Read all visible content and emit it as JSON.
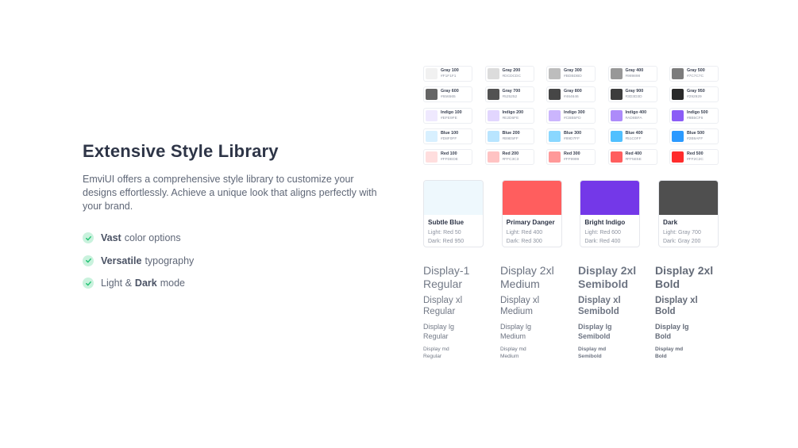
{
  "heading": "Extensive Style Library",
  "description": "EmviUI offers a comprehensive style library to customize your designs effortlessly. Achieve a unique look that aligns perfectly with your brand.",
  "features": [
    {
      "pre": "",
      "bold": "Vast",
      "post": "color options"
    },
    {
      "pre": "",
      "bold": "Versatile",
      "post": "typography"
    },
    {
      "pre": "Light &",
      "bold": "Dark",
      "post": "mode"
    }
  ],
  "check_color": "#22c373",
  "swatches": [
    [
      {
        "name": "Gray 100",
        "hex": "#F1F1F1",
        "color": "#f1f1f1"
      },
      {
        "name": "Gray 200",
        "hex": "#DCDCDC",
        "color": "#dcdcdc"
      },
      {
        "name": "Gray 300",
        "hex": "#BDBDBD",
        "color": "#bdbdbd"
      },
      {
        "name": "Gray 400",
        "hex": "#989898",
        "color": "#989898"
      },
      {
        "name": "Gray 500",
        "hex": "#7C7C7C",
        "color": "#7c7c7c"
      }
    ],
    [
      {
        "name": "Gray 600",
        "hex": "#656565",
        "color": "#656565"
      },
      {
        "name": "Gray 700",
        "hex": "#525252",
        "color": "#525252"
      },
      {
        "name": "Gray 800",
        "hex": "#464646",
        "color": "#464646"
      },
      {
        "name": "Gray 900",
        "hex": "#3D3D3D",
        "color": "#3d3d3d"
      },
      {
        "name": "Gray 950",
        "hex": "#292929",
        "color": "#292929"
      }
    ],
    [
      {
        "name": "Indigo 100",
        "hex": "#EFE9FE",
        "color": "#efe9fe"
      },
      {
        "name": "Indigo 200",
        "hex": "#E2D6FE",
        "color": "#e2d6fe"
      },
      {
        "name": "Indigo 300",
        "hex": "#CBB5FD",
        "color": "#cbb5fd"
      },
      {
        "name": "Indigo 400",
        "hex": "#AD8BFA",
        "color": "#ad8bfa"
      },
      {
        "name": "Indigo 500",
        "hex": "#8B5CF6",
        "color": "#8b5cf6"
      }
    ],
    [
      {
        "name": "Blue 100",
        "hex": "#D8F0FF",
        "color": "#d8f0ff"
      },
      {
        "name": "Blue 200",
        "hex": "#B9E5FF",
        "color": "#b9e5ff"
      },
      {
        "name": "Blue 300",
        "hex": "#89D7FF",
        "color": "#89d7ff"
      },
      {
        "name": "Blue 400",
        "hex": "#51C0FF",
        "color": "#51c0ff"
      },
      {
        "name": "Blue 500",
        "hex": "#2B9AFF",
        "color": "#2b9aff"
      }
    ],
    [
      {
        "name": "Red 100",
        "hex": "#FFDEDE",
        "color": "#ffdede"
      },
      {
        "name": "Red 200",
        "hex": "#FFC3C3",
        "color": "#ffc3c3"
      },
      {
        "name": "Red 300",
        "hex": "#FF9999",
        "color": "#ff9999"
      },
      {
        "name": "Red 400",
        "hex": "#FF5E5E",
        "color": "#ff5e5e"
      },
      {
        "name": "Red 500",
        "hex": "#FF2C2C",
        "color": "#ff2c2c"
      }
    ]
  ],
  "cards": [
    {
      "name": "Subtle Blue",
      "light": "Light: Red 50",
      "dark": "Dark: Red 950",
      "color": "#eef8fd"
    },
    {
      "name": "Primary Danger",
      "light": "Light: Red 400",
      "dark": "Dark: Red 300",
      "color": "#ff5e5e"
    },
    {
      "name": "Bright Indigo",
      "light": "Light: Red 600",
      "dark": "Dark: Red 400",
      "color": "#7438e8"
    },
    {
      "name": "Dark",
      "light": "Light: Gray 700",
      "dark": "Dark: Gray 200",
      "color": "#4f4f4f"
    }
  ],
  "typography": [
    {
      "d2xl": [
        "Display-1",
        "Regular"
      ],
      "dxl": [
        "Display xl",
        "Regular"
      ],
      "dlg": [
        "Display lg",
        "Regular"
      ],
      "dmd": [
        "Display md",
        "Regular"
      ]
    },
    {
      "d2xl": [
        "Display 2xl",
        "Medium"
      ],
      "dxl": [
        "Display xl",
        "Medium"
      ],
      "dlg": [
        "Display lg",
        "Medium"
      ],
      "dmd": [
        "Display md",
        "Medium"
      ]
    },
    {
      "d2xl": [
        "Display 2xl",
        "Semibold"
      ],
      "dxl": [
        "Display xl",
        "Semibold"
      ],
      "dlg": [
        "Display lg",
        "Semibold"
      ],
      "dmd": [
        "Display md",
        "Semibold"
      ]
    },
    {
      "d2xl": [
        "Display 2xl",
        "Bold"
      ],
      "dxl": [
        "Display xl",
        "Bold"
      ],
      "dlg": [
        "Display lg",
        "Bold"
      ],
      "dmd": [
        "Display md",
        "Bold"
      ]
    }
  ]
}
